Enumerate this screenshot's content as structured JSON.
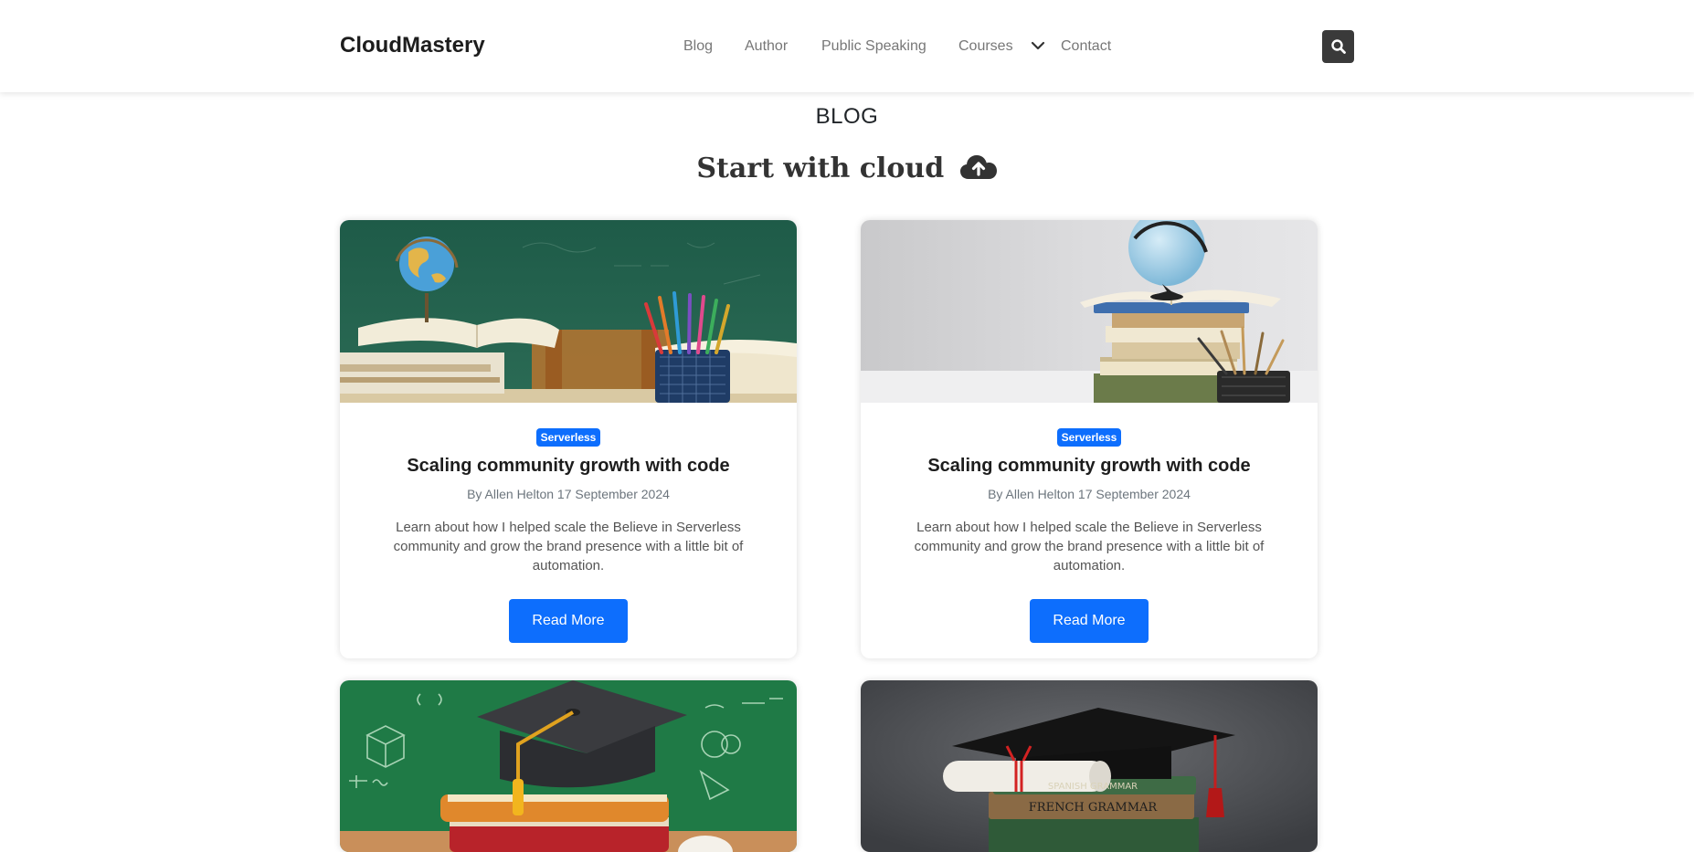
{
  "header": {
    "brand": "CloudMastery",
    "nav": [
      {
        "label": "Blog"
      },
      {
        "label": "Author"
      },
      {
        "label": "Public Speaking"
      },
      {
        "label": "Courses"
      },
      {
        "label": "Contact"
      }
    ],
    "search_icon": "search-icon"
  },
  "main": {
    "section_label": "BLOG",
    "heading": "Start with cloud",
    "heading_icon": "cloud-upload-icon"
  },
  "colors": {
    "accent": "#0d6efd",
    "search_bg": "#3a3a3a"
  },
  "cards": [
    {
      "image": "books-pencils-chalkboard-image",
      "badge": "Serverless",
      "title": "Scaling community growth with code",
      "byline": "By Allen Helton 17 September 2024",
      "excerpt": "Learn about how I helped scale the Believe in Serverless community and grow the brand presence with a little bit of automation.",
      "button": "Read More"
    },
    {
      "image": "books-globe-image",
      "badge": "Serverless",
      "title": "Scaling community growth with code",
      "byline": "By Allen Helton 17 September 2024",
      "excerpt": "Learn about how I helped scale the Believe in Serverless community and grow the brand presence with a little bit of automation.",
      "button": "Read More"
    },
    {
      "image": "graduation-cap-chalkboard-image"
    },
    {
      "image": "graduation-cap-grammar-books-image"
    }
  ]
}
